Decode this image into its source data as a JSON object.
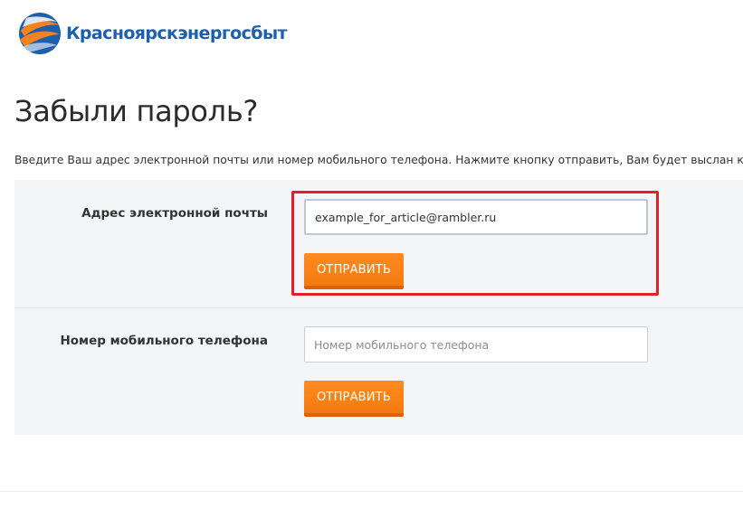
{
  "header": {
    "logo_text": "Красноярскэнергосбыт",
    "logo_icon": "globe-swirl-logo",
    "brand_colors": {
      "blue": "#1d5fab",
      "orange": "#f58220"
    }
  },
  "page": {
    "title": "Забыли пароль?",
    "instructions": "Введите Ваш адрес электронной почты или номер мобильного телефона. Нажмите кнопку отправить, Вам будет выслан код для"
  },
  "form": {
    "email": {
      "label": "Адрес электронной почты",
      "value": "example_for_article@rambler.ru",
      "placeholder": "",
      "submit_label": "ОТПРАВИТЬ"
    },
    "phone": {
      "label": "Номер мобильного телефона",
      "value": "",
      "placeholder": "Номер мобильного телефона",
      "submit_label": "ОТПРАВИТЬ"
    },
    "button_color": "#f47a10",
    "highlight_color": "#e3202a"
  }
}
